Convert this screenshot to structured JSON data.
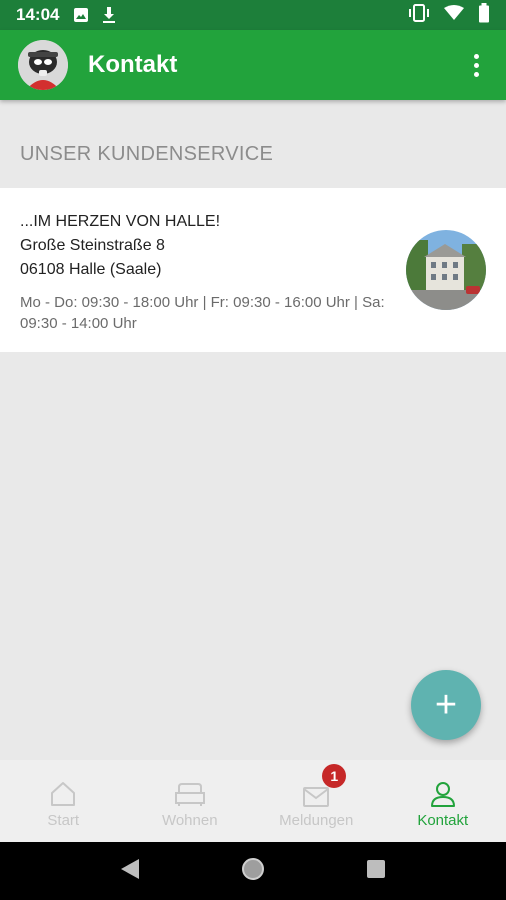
{
  "status_bar": {
    "time": "14:04",
    "icons": [
      "image-icon",
      "download-icon",
      "vibrate-icon",
      "wifi-icon",
      "battery-icon"
    ]
  },
  "app_bar": {
    "title": "Kontakt",
    "menu_icon": "more-vert-icon"
  },
  "section": {
    "header": "UNSER KUNDENSERVICE"
  },
  "contact_card": {
    "name": "...IM HERZEN VON HALLE!",
    "street": "Große Steinstraße 8",
    "city": "06108 Halle (Saale)",
    "hours": "Mo - Do: 09:30 - 18:00 Uhr | Fr: 09:30 - 16:00 Uhr | Sa: 09:30 - 14:00 Uhr"
  },
  "fab": {
    "label": "+"
  },
  "bottom_nav": {
    "items": [
      {
        "label": "Start",
        "icon": "home-icon",
        "active": false
      },
      {
        "label": "Wohnen",
        "icon": "sofa-icon",
        "active": false
      },
      {
        "label": "Meldungen",
        "icon": "mail-icon",
        "active": false,
        "badge": "1"
      },
      {
        "label": "Kontakt",
        "icon": "person-icon",
        "active": true
      }
    ]
  },
  "colors": {
    "primary": "#22a33c",
    "status_bar": "#1d7f3a",
    "fab": "#5fb3b0",
    "badge": "#c62828"
  }
}
